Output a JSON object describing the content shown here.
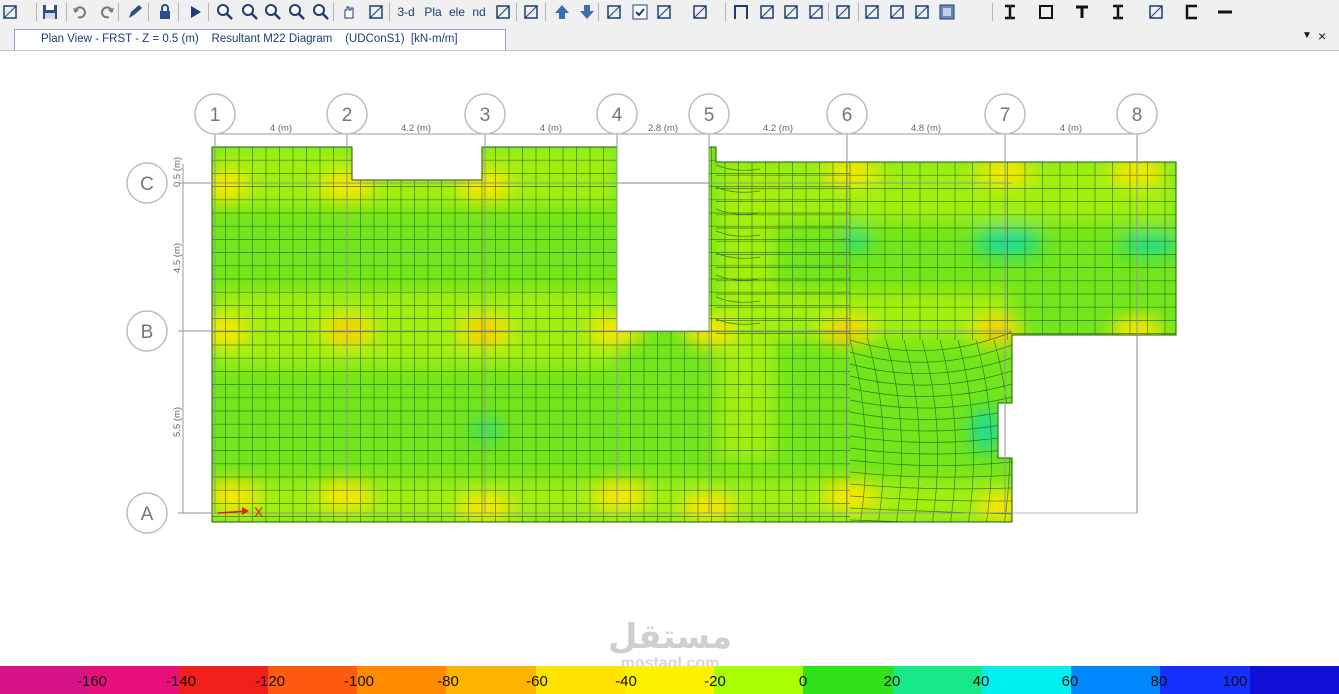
{
  "toolbar": {
    "tools": [
      {
        "name": "pin-icon"
      },
      {
        "name": "save-icon"
      },
      {
        "name": "undo-icon"
      },
      {
        "name": "redo-icon"
      },
      {
        "name": "pencil-icon"
      },
      {
        "name": "lock-icon"
      },
      {
        "name": "run-icon"
      },
      {
        "name": "zoom-window-icon"
      },
      {
        "name": "zoom-in-icon"
      },
      {
        "name": "zoom-out-icon"
      },
      {
        "name": "zoom-all-icon"
      },
      {
        "name": "zoom-previous-icon"
      },
      {
        "name": "pan-icon"
      },
      {
        "name": "rubber-band-icon"
      },
      {
        "name": "view-3d-button",
        "label": "3-d"
      },
      {
        "name": "view-plan-button",
        "label": "Pla"
      },
      {
        "name": "view-elevation-button",
        "label": "ele"
      },
      {
        "name": "view-nd-button",
        "label": "nd"
      },
      {
        "name": "rotate-icon"
      },
      {
        "name": "perspective-icon"
      },
      {
        "name": "move-up-icon"
      },
      {
        "name": "move-down-icon"
      },
      {
        "name": "select-icon"
      },
      {
        "name": "check-icon"
      },
      {
        "name": "object-shrink-icon"
      },
      {
        "name": "extrude-icon"
      },
      {
        "name": "frame-icon"
      },
      {
        "name": "brace-icon"
      },
      {
        "name": "wall-icon"
      },
      {
        "name": "ramp-icon"
      },
      {
        "name": "column-icon"
      },
      {
        "name": "load-icon"
      },
      {
        "name": "deck-icon"
      },
      {
        "name": "mesh-icon"
      },
      {
        "name": "shell-icon"
      },
      {
        "name": "beam-section-icon"
      },
      {
        "name": "slab-section-icon"
      },
      {
        "name": "tee-section-icon"
      },
      {
        "name": "i-section-icon"
      },
      {
        "name": "rebar-icon"
      },
      {
        "name": "channel-icon"
      },
      {
        "name": "dash-icon"
      }
    ]
  },
  "tab": {
    "caption": "Plan View - FRST - Z = 0.5 (m)    Resultant M22 Diagram    (UDConS1)  [kN-m/m]",
    "menu_glyph": "▼",
    "close_glyph": "×"
  },
  "grid": {
    "x_bubbles": [
      "1",
      "2",
      "3",
      "4",
      "5",
      "6",
      "7",
      "8"
    ],
    "y_bubbles": [
      "C",
      "B",
      "A"
    ],
    "x_spacings": [
      "4 (m)",
      "4.2 (m)",
      "4 (m)",
      "2.8 (m)",
      "4.2 (m)",
      "4.8 (m)",
      "4 (m)"
    ],
    "y_spacings": [
      "0.5 (m)",
      "4.5 (m)",
      "5.5 (m)"
    ]
  },
  "axis": {
    "x_label": "X"
  },
  "legend": {
    "labels": [
      "-160",
      "-140",
      "-120",
      "-100",
      "-80",
      "-60",
      "-40",
      "-20",
      "0",
      "20",
      "40",
      "60",
      "80",
      "100"
    ],
    "colors": [
      "#d71385",
      "#e8107a",
      "#f2201a",
      "#ff5a10",
      "#ff8c00",
      "#ffb400",
      "#ffe200",
      "#fff200",
      "#aaff00",
      "#2fe21a",
      "#17e88a",
      "#00f0f0",
      "#0088ff",
      "#1830ff",
      "#1010d8"
    ]
  },
  "watermark": {
    "arabic": "مستقل",
    "latin": "mostaql.com"
  }
}
